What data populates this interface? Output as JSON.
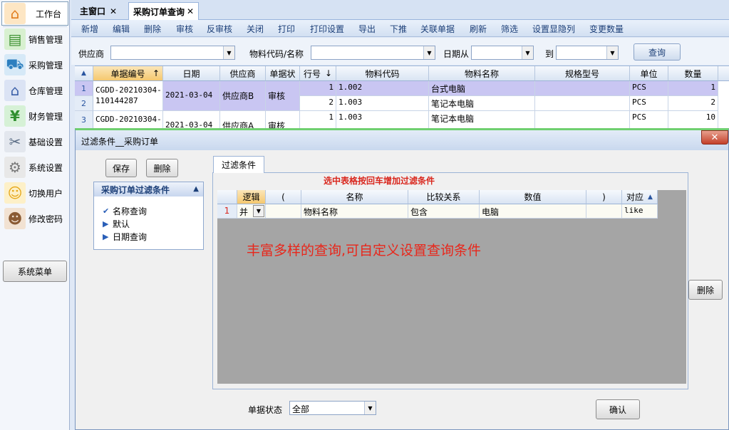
{
  "sidebar": {
    "items": [
      {
        "label": "工作台",
        "icon": "home-icon",
        "color": "#e07b1a"
      },
      {
        "label": "销售管理",
        "icon": "cash-register-icon",
        "color": "#3a8f2e"
      },
      {
        "label": "采购管理",
        "icon": "cart-icon",
        "color": "#2d7fbf"
      },
      {
        "label": "仓库管理",
        "icon": "warehouse-icon",
        "color": "#3b5fa8"
      },
      {
        "label": "财务管理",
        "icon": "yen-icon",
        "color": "#2f8f2f"
      },
      {
        "label": "基础设置",
        "icon": "tools-icon",
        "color": "#5a6c84"
      },
      {
        "label": "系统设置",
        "icon": "gear-icon",
        "color": "#7a7a7a"
      },
      {
        "label": "切换用户",
        "icon": "user-switch-icon",
        "color": "#e5a617"
      },
      {
        "label": "修改密码",
        "icon": "person-icon",
        "color": "#8a5a33"
      }
    ],
    "system_menu": "系统菜单"
  },
  "tabs": [
    {
      "label": "主窗口",
      "close": "✕"
    },
    {
      "label": "采购订单查询",
      "close": "✕"
    }
  ],
  "toolbar": [
    "新增",
    "编辑",
    "删除",
    "审核",
    "反审核",
    "关闭",
    "打印",
    "打印设置",
    "导出",
    "下推",
    "关联单据",
    "刷新",
    "筛选",
    "设置显隐列",
    "变更数量"
  ],
  "search": {
    "supplier_label": "供应商",
    "material_label": "物料代码/名称",
    "date_from_label": "日期从",
    "date_to_label": "到",
    "query_button": "查询"
  },
  "grid": {
    "headers": [
      "单据编号",
      "日期",
      "供应商",
      "单据状",
      "行号",
      "物料代码",
      "物料名称",
      "规格型号",
      "单位",
      "数量"
    ],
    "sort_up": "↑",
    "sort_down": "↓",
    "rows": [
      {
        "num": "1",
        "doc": "CGDD-20210304-",
        "doc2": "110144287",
        "date": "2021-03-04",
        "supplier": "供应商B",
        "status": "审核",
        "line": "1",
        "code": "1.002",
        "name": "台式电脑",
        "unit": "PCS",
        "qty": "1"
      },
      {
        "num": "2",
        "line": "2",
        "code": "1.003",
        "name": "笔记本电脑",
        "unit": "PCS",
        "qty": "2"
      },
      {
        "num": "3",
        "doc": "CGDD-20210304-",
        "date": "2021-03-04",
        "supplier": "供应商A",
        "status": "审核",
        "line": "1",
        "code": "1.003",
        "name": "笔记本电脑",
        "unit": "PCS",
        "qty": "10"
      }
    ]
  },
  "dialog": {
    "title": "过滤条件__采购订单",
    "close": "✕",
    "save_button": "保存",
    "delete_button": "删除",
    "filter_panel_title": "采购订单过滤条件",
    "filter_items": [
      "名称查询",
      "默认",
      "日期查询"
    ],
    "tab_label": "过滤条件",
    "hint": "选中表格按回车增加过滤条件",
    "filter_headers": [
      "逻辑",
      "(",
      "名称",
      "比较关系",
      "数值",
      ")",
      "对应"
    ],
    "filter_row": {
      "num": "1",
      "logic": "并",
      "name": "物料名称",
      "relation": "包含",
      "value": "电脑",
      "match": "like"
    },
    "big_hint": "丰富多样的查询,可自定义设置查询条件",
    "right_delete_button": "删除",
    "status_label": "单据状态",
    "status_value": "全部",
    "confirm_button": "确认"
  },
  "colors": {
    "accent": "#1c3f78",
    "hint_red": "#e8271b",
    "highlight_row": "#c9c6f2"
  }
}
